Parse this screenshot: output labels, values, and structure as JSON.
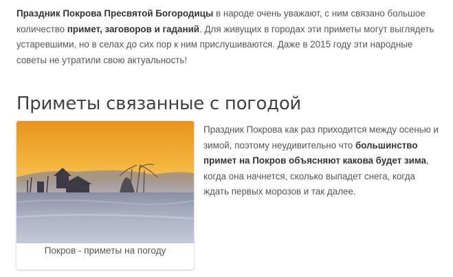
{
  "intro": {
    "strong1": "Праздник Покрова Пресвятой Богородицы",
    "text1": " в народе очень уважают, с ним связано большое количество ",
    "strong2": "примет, заговоров и гаданий",
    "text2": ". Для живущих в городах эти приметы могут выглядеть устаревшими, но в селах до сих пор к ним прислушиваются. Даже в 2015 году эти народные советы не утратили свою актуальность!"
  },
  "section": {
    "heading": "Приметы связанные с погодой"
  },
  "figure": {
    "image_icon": "winter-sunrise-village-image",
    "caption": "Покров - приметы на погоду"
  },
  "side": {
    "text1": "Праздник Покрова как раз приходится между осенью и зимой, поэтому неудивительно что ",
    "strong": "большинство примет на Покров объясняют какова будет зима",
    "text2": ", когда она начнется, сколько выпадет снега, когда ждать первых морозов и так далее."
  },
  "colors": {
    "text": "#555555",
    "strong": "#333333",
    "heading": "#404040",
    "sky_top": "#f0a020",
    "sky_bottom": "#f7d58a",
    "snow": "#a9b3c6"
  }
}
